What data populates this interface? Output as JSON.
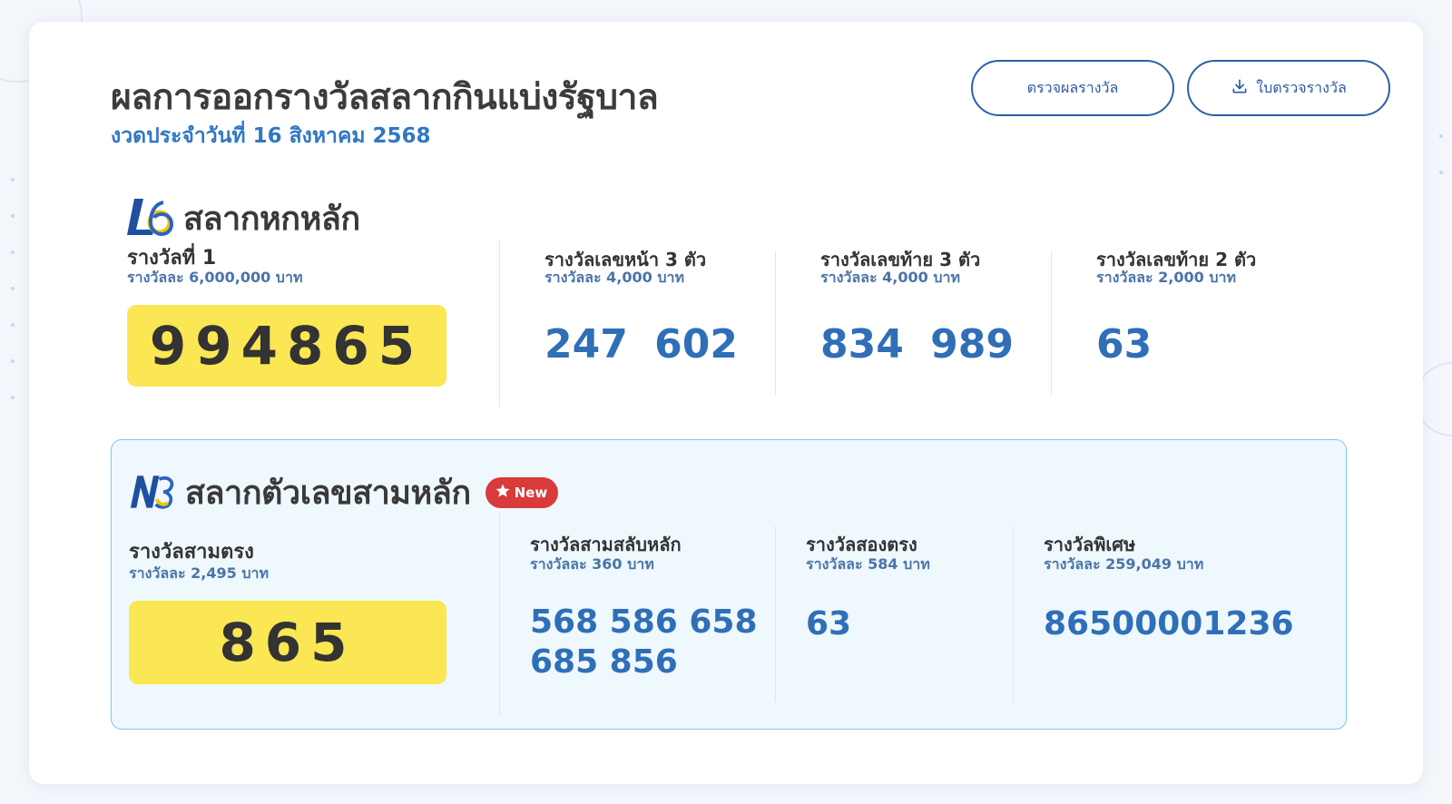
{
  "header": {
    "title": "ผลการออกรางวัลสลากกินแบ่งรัฐบาล",
    "subtitle": "งวดประจำวันที่ 16 สิงหาคม 2568",
    "check_button": "ตรวจผลรางวัล",
    "download_button": "ใบตรวจรางวัล",
    "download_icon": "download-icon"
  },
  "l6": {
    "logo": "L6-logo",
    "title": "สลากหกหลัก",
    "first_prize": {
      "label": "รางวัลที่ 1",
      "amount": "รางวัลละ 6,000,000 บาท",
      "number": "994865"
    },
    "front3": {
      "label": "รางวัลเลขหน้า 3 ตัว",
      "amount": "รางวัลละ 4,000 บาท",
      "numbers": "247 602"
    },
    "last3": {
      "label": "รางวัลเลขท้าย 3 ตัว",
      "amount": "รางวัลละ 4,000 บาท",
      "numbers": "834 989"
    },
    "last2": {
      "label": "รางวัลเลขท้าย 2 ตัว",
      "amount": "รางวัลละ 2,000 บาท",
      "numbers": "63"
    }
  },
  "n3": {
    "logo": "N3-logo",
    "title": "สลากตัวเลขสามหลัก",
    "badge": "New",
    "straight3": {
      "label": "รางวัลสามตรง",
      "amount": "รางวัลละ 2,495 บาท",
      "number": "865"
    },
    "shuffle3": {
      "label": "รางวัลสามสลับหลัก",
      "amount": "รางวัลละ 360 บาท",
      "line1": "568 586 658",
      "line2": "685 856"
    },
    "straight2": {
      "label": "รางวัลสองตรง",
      "amount": "รางวัลละ 584 บาท",
      "number": "63"
    },
    "special": {
      "label": "รางวัลพิเศษ",
      "amount": "รางวัลละ 259,049 บาท",
      "number": "86500001236"
    }
  },
  "colors": {
    "accent_blue": "#2f6fb8",
    "highlight_yellow": "#fbe653",
    "badge_red": "#d93a3a",
    "n3_panel_bg": "#eef8fd",
    "n3_panel_border": "#7cc7ec"
  }
}
